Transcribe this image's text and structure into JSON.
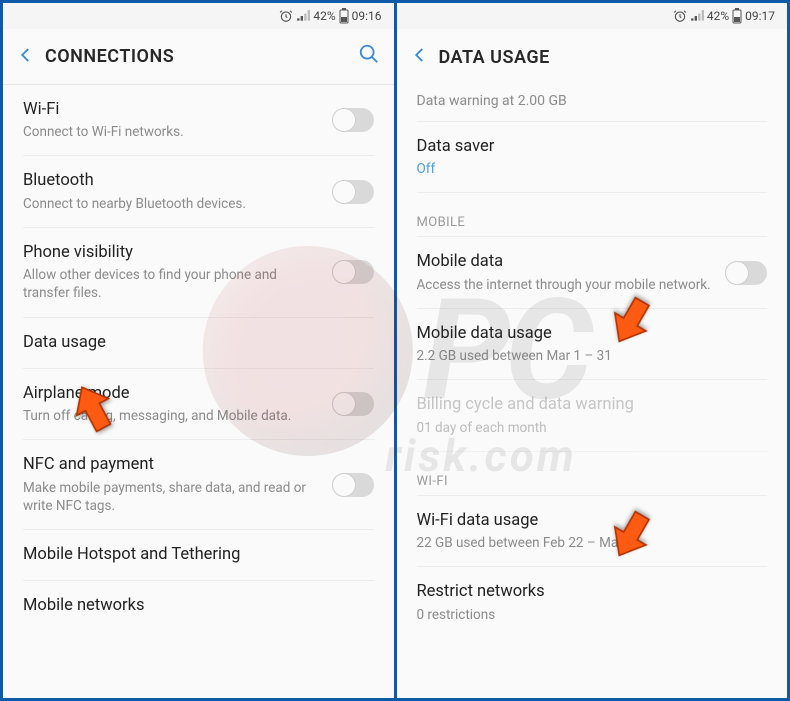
{
  "statusbar": {
    "alarm_icon": "⏰",
    "signal_icon": "📶",
    "battery_pct_left": "42%",
    "battery_icon": "▮",
    "time_left": "09:16",
    "battery_pct_right": "42%",
    "time_right": "09:17"
  },
  "left": {
    "header_title": "CONNECTIONS",
    "rows": {
      "wifi": {
        "title": "Wi-Fi",
        "sub": "Connect to Wi-Fi networks."
      },
      "bluetooth": {
        "title": "Bluetooth",
        "sub": "Connect to nearby Bluetooth devices."
      },
      "phone_visibility": {
        "title": "Phone visibility",
        "sub": "Allow other devices to find your phone and transfer files."
      },
      "data_usage": {
        "title": "Data usage"
      },
      "airplane": {
        "title": "Airplane mode",
        "sub": "Turn off calling, messaging, and Mobile data."
      },
      "nfc": {
        "title": "NFC and payment",
        "sub": "Make mobile payments, share data, and read or write NFC tags."
      },
      "hotspot": {
        "title": "Mobile Hotspot and Tethering"
      },
      "networks": {
        "title": "Mobile networks"
      }
    }
  },
  "right": {
    "header_title": "DATA USAGE",
    "sub_header": "Data warning at 2.00 GB",
    "data_saver": {
      "title": "Data saver",
      "sub": "Off"
    },
    "section_mobile": "MOBILE",
    "mobile_data": {
      "title": "Mobile data",
      "sub": "Access the internet through your mobile network."
    },
    "mobile_data_usage": {
      "title": "Mobile data usage",
      "sub": "2.2 GB used between Mar 1 – 31"
    },
    "billing_cycle": {
      "title": "Billing cycle and data warning",
      "sub": "01 day of each month"
    },
    "section_wifi": "WI-FI",
    "wifi_data_usage": {
      "title": "Wi-Fi data usage",
      "sub": "22 GB used between Feb 22 – Mar 21"
    },
    "restrict": {
      "title": "Restrict networks",
      "sub": "0 restrictions"
    }
  },
  "watermark": {
    "text": "PC",
    "small": "risk.com"
  }
}
